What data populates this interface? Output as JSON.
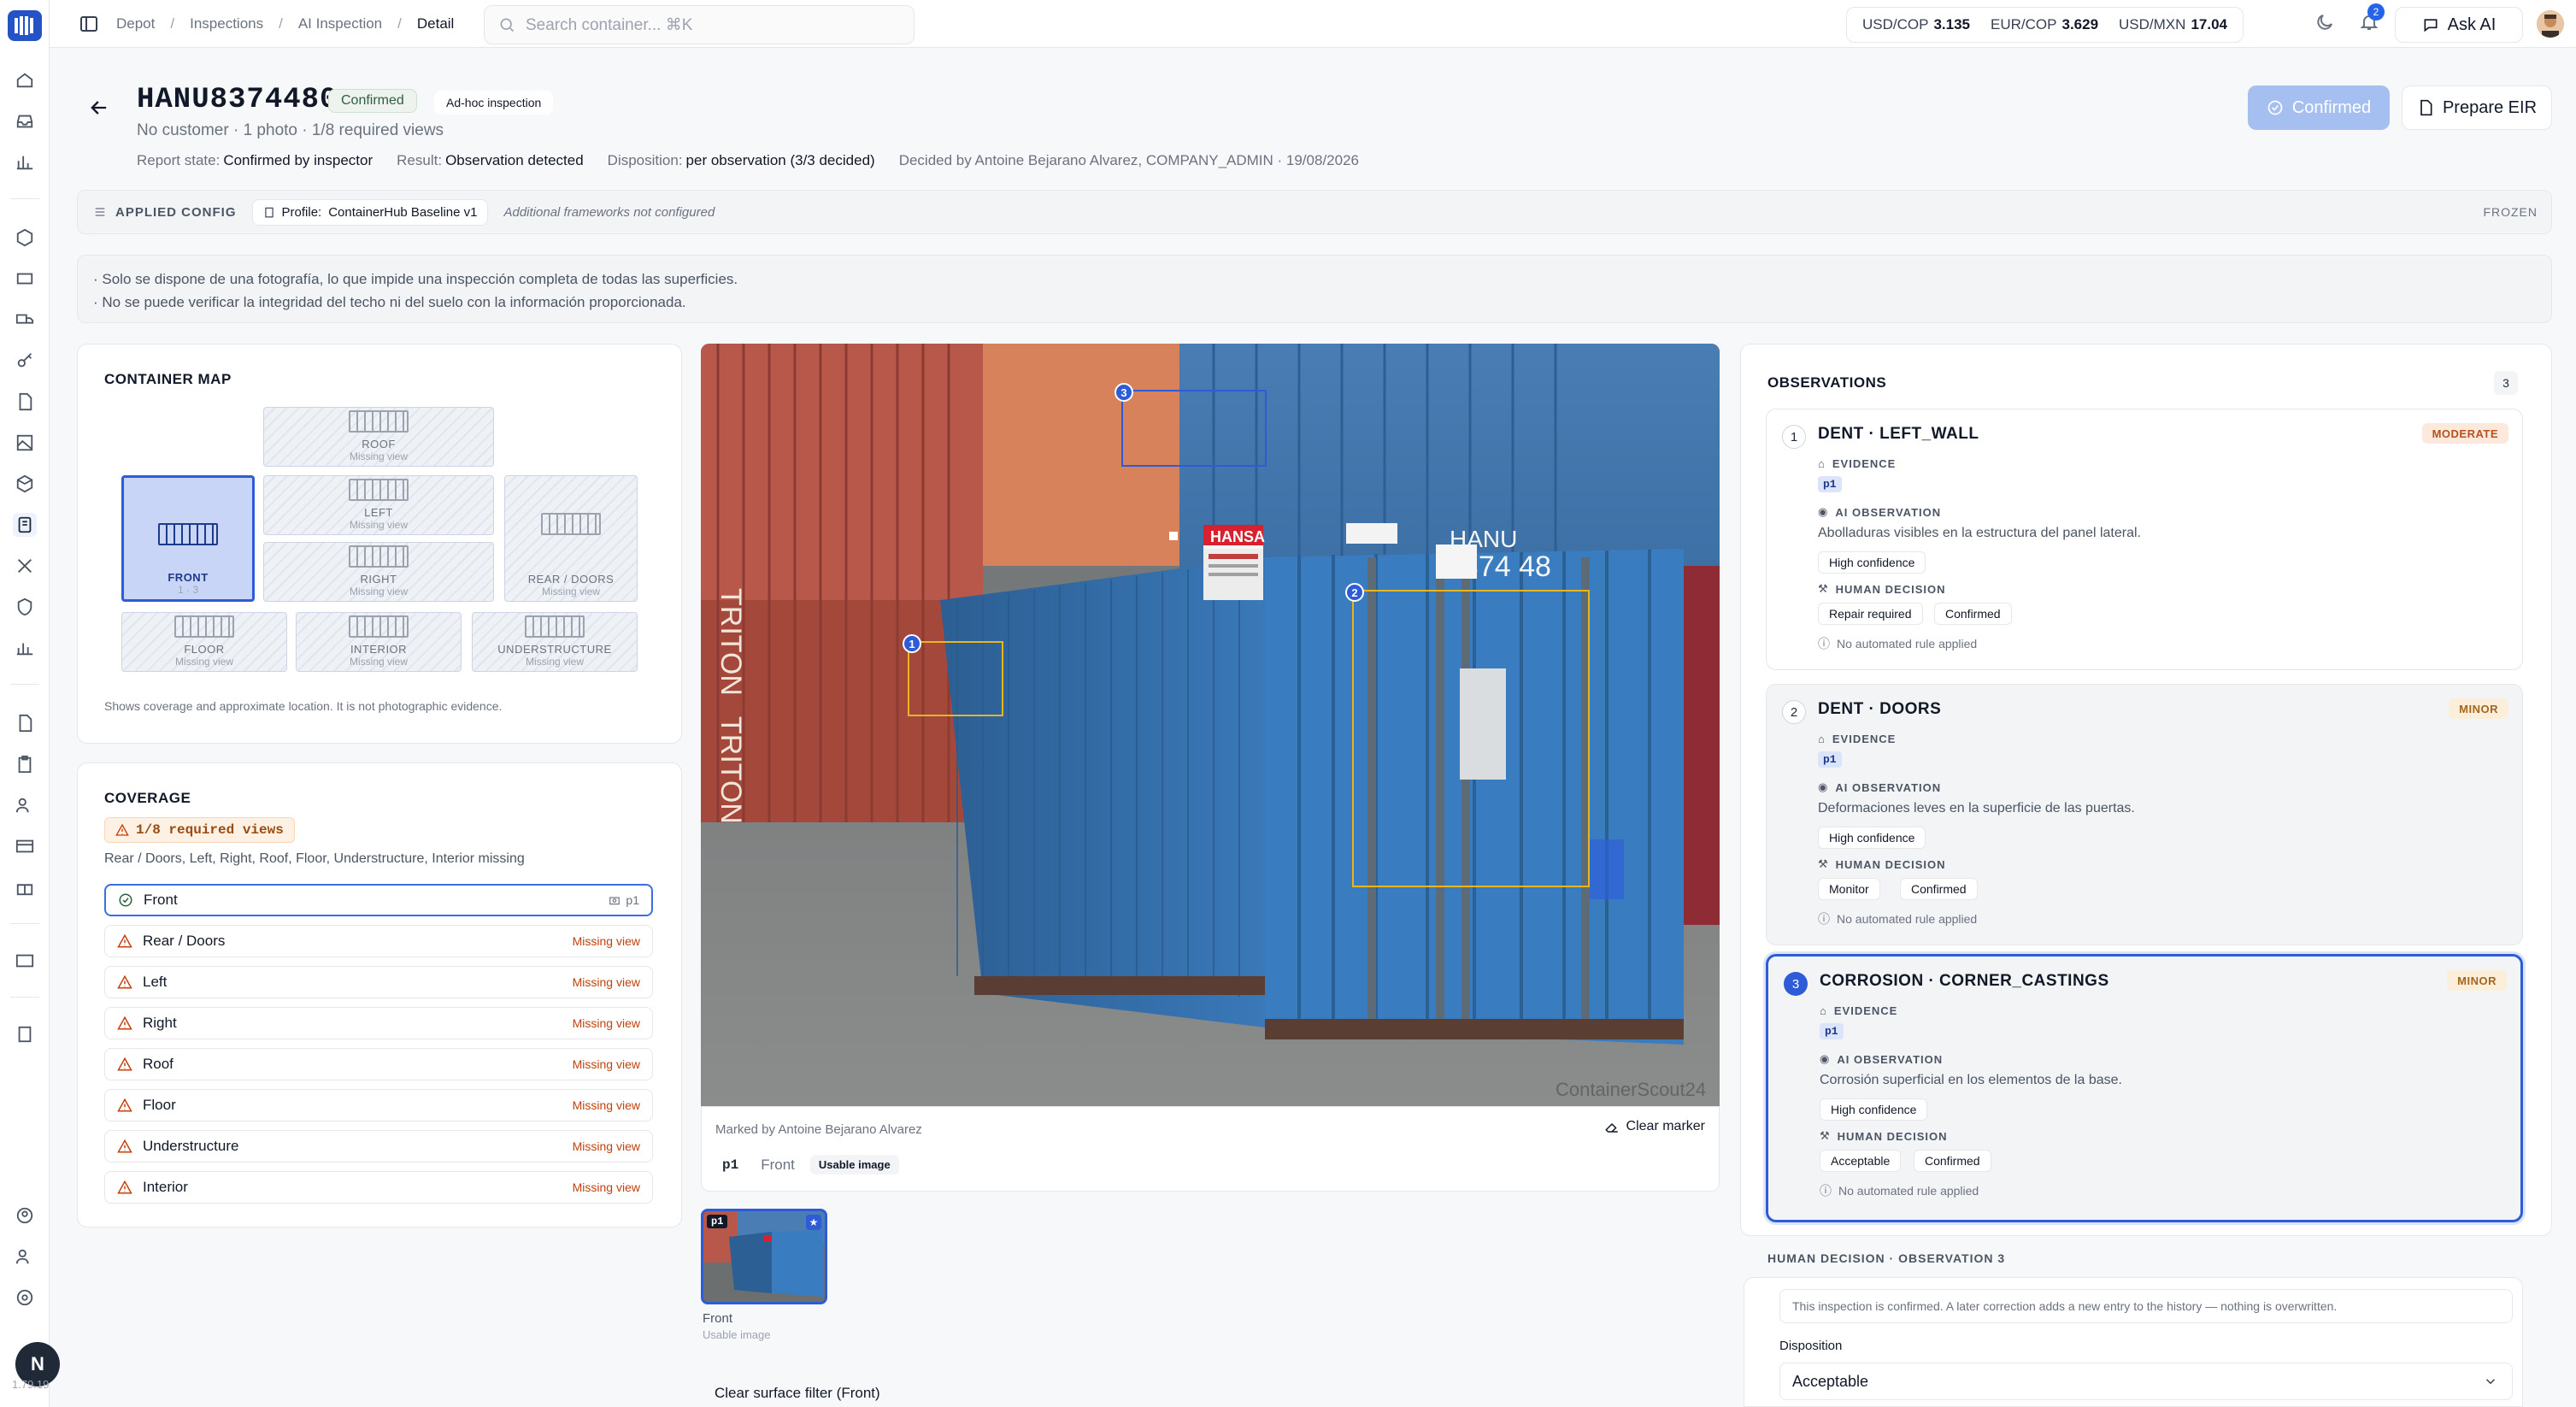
{
  "nav": {
    "breadcrumbs": [
      "Depot",
      "Inspections",
      "AI Inspection",
      "Detail"
    ],
    "search_placeholder": "Search container... ⌘K",
    "fx": [
      {
        "pair": "USD/COP",
        "value": "3.135"
      },
      {
        "pair": "EUR/COP",
        "value": "3.629"
      },
      {
        "pair": "USD/MXN",
        "value": "17.04"
      }
    ],
    "notifications_count": "2",
    "ask_ai_label": "Ask AI",
    "rail_avatar": "N",
    "version": "1.79.19"
  },
  "header": {
    "container_id": "HANU8374480",
    "status_badge": "Confirmed",
    "type_badge": "Ad-hoc inspection",
    "subline": "No customer · 1 photo · 1/8 required views",
    "report_state_label": "Report state:",
    "report_state": "Confirmed by inspector",
    "result_label": "Result:",
    "result": "Observation detected",
    "disposition_label": "Disposition:",
    "disposition": "per observation (3/3 decided)",
    "decided_by": "Decided by Antoine Bejarano Alvarez, COMPANY_ADMIN · 19/08/2026",
    "confirmed_button": "Confirmed",
    "prepare_eir_button": "Prepare EIR"
  },
  "config": {
    "label": "APPLIED CONFIG",
    "profile_label": "Profile:",
    "profile": "ContainerHub Baseline v1",
    "extra": "Additional frameworks not configured",
    "state": "FROZEN"
  },
  "notes": [
    "· Solo se dispone de una fotografía, lo que impide una inspección completa de todas las superficies.",
    "· No se puede verificar la integridad del techo ni del suelo con la información proporcionada."
  ],
  "container_map": {
    "title": "CONTAINER MAP",
    "cells": {
      "roof": {
        "name": "ROOF",
        "status": "Missing view"
      },
      "front": {
        "name": "FRONT",
        "status": "1 · 3"
      },
      "left": {
        "name": "LEFT",
        "status": "Missing view"
      },
      "right": {
        "name": "RIGHT",
        "status": "Missing view"
      },
      "rear": {
        "name": "REAR / DOORS",
        "status": "Missing view"
      },
      "floor": {
        "name": "FLOOR",
        "status": "Missing view"
      },
      "interior": {
        "name": "INTERIOR",
        "status": "Missing view"
      },
      "under": {
        "name": "UNDERSTRUCTURE",
        "status": "Missing view"
      }
    },
    "footnote": "Shows coverage and approximate location. It is not photographic evidence."
  },
  "coverage": {
    "title": "COVERAGE",
    "badge": "1/8 required views",
    "missing_summary": "Rear / Doors, Left, Right, Roof, Floor, Understructure, Interior missing",
    "rows": [
      {
        "label": "Front",
        "status": "p1"
      },
      {
        "label": "Rear / Doors",
        "status": "Missing view"
      },
      {
        "label": "Left",
        "status": "Missing view"
      },
      {
        "label": "Right",
        "status": "Missing view"
      },
      {
        "label": "Roof",
        "status": "Missing view"
      },
      {
        "label": "Floor",
        "status": "Missing view"
      },
      {
        "label": "Understructure",
        "status": "Missing view"
      },
      {
        "label": "Interior",
        "status": "Missing view"
      }
    ]
  },
  "photo": {
    "marked_by": "Marked by Antoine Bejarano Alvarez",
    "clear_marker": "Clear marker",
    "tab_id": "p1",
    "tab_side": "Front",
    "tab_quality": "Usable image",
    "thumb_id": "p1",
    "thumb_side": "Front",
    "thumb_quality": "Usable image",
    "clear_filter": "Clear surface filter (Front)",
    "container_text": "HANU",
    "container_num": "8374 48",
    "brand": "HANSA",
    "triton": "TRITON",
    "watermark": "ContainerScout24",
    "markers": [
      "1",
      "2",
      "3"
    ]
  },
  "observations": {
    "title": "OBSERVATIONS",
    "count": "3",
    "evidence_label": "EVIDENCE",
    "ai_label": "AI OBSERVATION",
    "human_label": "HUMAN DECISION",
    "rule_text": "No automated rule applied",
    "items": [
      {
        "num": "1",
        "title": "DENT · LEFT_WALL",
        "severity": "MODERATE",
        "evidence": "p1",
        "ai_text": "Abolladuras visibles en la estructura del panel lateral.",
        "confidence": "High confidence",
        "decision": "Repair required",
        "decision_state": "Confirmed"
      },
      {
        "num": "2",
        "title": "DENT · DOORS",
        "severity": "MINOR",
        "evidence": "p1",
        "ai_text": "Deformaciones leves en la superficie de las puertas.",
        "confidence": "High confidence",
        "decision": "Monitor",
        "decision_state": "Confirmed"
      },
      {
        "num": "3",
        "title": "CORROSION · CORNER_CASTINGS",
        "severity": "MINOR",
        "evidence": "p1",
        "ai_text": "Corrosión superficial en los elementos de la base.",
        "confidence": "High confidence",
        "decision": "Acceptable",
        "decision_state": "Confirmed"
      }
    ]
  },
  "human_decision": {
    "label": "HUMAN DECISION · OBSERVATION 3",
    "note": "This inspection is confirmed. A later correction adds a new entry to the history — nothing is overwritten.",
    "disposition_label": "Disposition",
    "disposition_value": "Acceptable"
  },
  "colors": {
    "accent": "#2e5bd6",
    "container_blue": "#2f73b5",
    "marker_yellow": "#e7b51d"
  }
}
